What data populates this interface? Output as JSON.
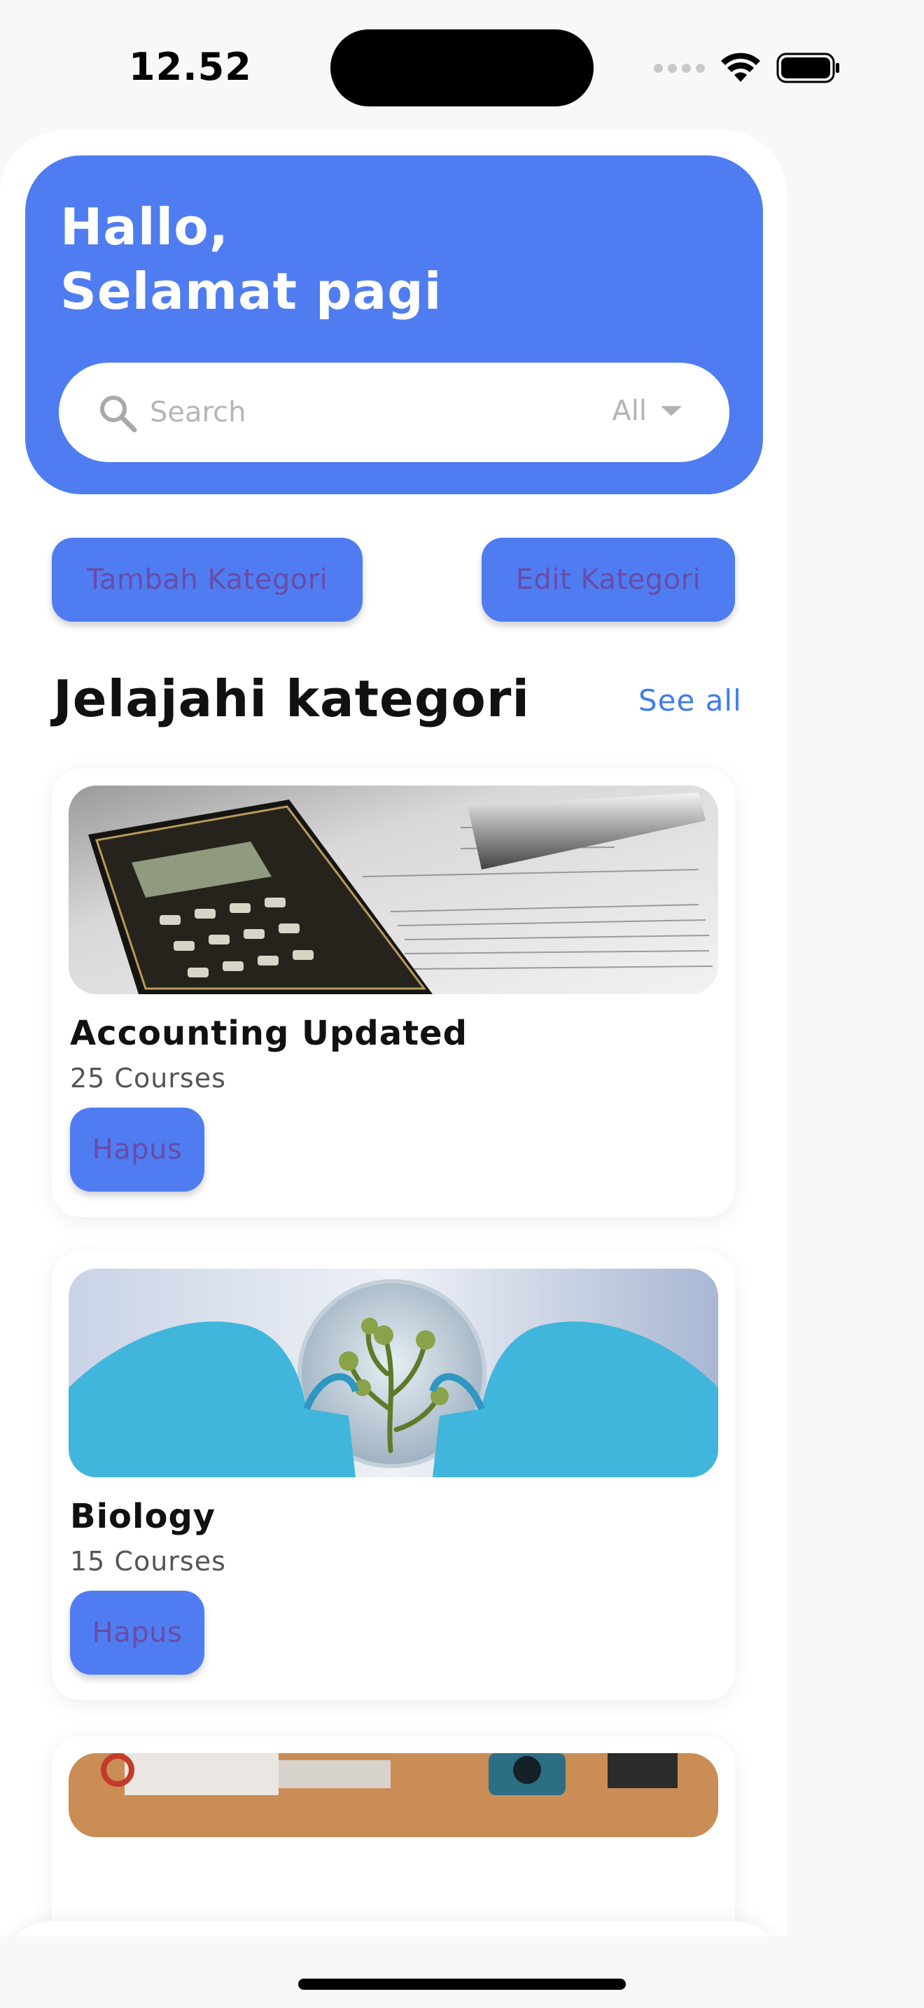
{
  "status_bar": {
    "time": "12.52"
  },
  "header": {
    "greeting": "Hallo,\nSelamat pagi"
  },
  "search": {
    "placeholder": "Search",
    "value": "",
    "filter": "All"
  },
  "actions": {
    "add_label": "Tambah Kategori",
    "edit_label": "Edit Kategori"
  },
  "section": {
    "title": "Jelajahi kategori",
    "see_all": "See all"
  },
  "categories": [
    {
      "name": "Accounting Updated",
      "count": "25 Courses",
      "delete_label": "Hapus"
    },
    {
      "name": "Biology",
      "count": "15 Courses",
      "delete_label": "Hapus"
    }
  ],
  "nav": {
    "items": [
      "home-icon",
      "chat-icon",
      "bell-icon",
      "profile-icon"
    ],
    "active": "home-icon"
  },
  "colors": {
    "primary": "#4f7df1",
    "button_text": "#6a4ba8",
    "link": "#3f7df0",
    "nav_active_bg": "#cfe0fb"
  }
}
